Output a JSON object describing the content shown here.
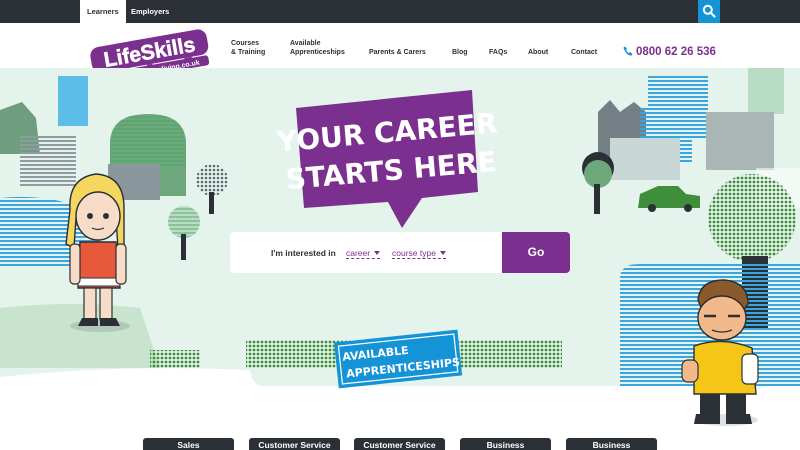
{
  "topbar": {
    "learners": "Learners",
    "employers": "Employers"
  },
  "logo": {
    "name": "LifeSkills",
    "url": "www.learnaliving.co.uk"
  },
  "nav": {
    "courses_l1": "Courses",
    "courses_l2": "& Training",
    "apprenticeships_l1": "Available",
    "apprenticeships_l2": "Apprenticeships",
    "parents": "Parents & Carers",
    "blog": "Blog",
    "faqs": "FAQs",
    "about": "About",
    "contact": "Contact"
  },
  "phone": "0800 62 26 536",
  "hero": {
    "headline_l1": "YOUR CAREER",
    "headline_l2": "STARTS HERE",
    "badge_l1": "AVAILABLE",
    "badge_l2": "APPRENTICESHIPS"
  },
  "search": {
    "label": "I'm interested in",
    "dropdown1": "career",
    "dropdown2": "course type",
    "go": "Go"
  },
  "category_tabs": [
    "Sales",
    "Customer Service",
    "Customer Service",
    "Business",
    "Business"
  ],
  "colors": {
    "dark": "#2b3036",
    "purple": "#7b2f8e",
    "blue": "#1493d6",
    "green": "#3e8e3a",
    "mint": "#e4f3ec"
  }
}
